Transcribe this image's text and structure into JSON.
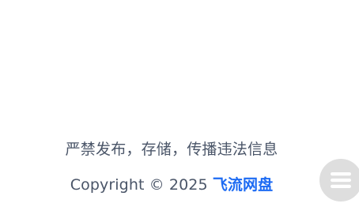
{
  "footer": {
    "notice": "严禁发布，存储，传播违法信息",
    "copyright_prefix": "Copyright © 2025 ",
    "brand": "飞流网盘"
  },
  "floating_menu": {
    "icon": "menu-icon",
    "background": "#dedede",
    "icon_color": "#ffffff"
  },
  "colors": {
    "text": "#4a5568",
    "brand": "#1d6bf3"
  }
}
